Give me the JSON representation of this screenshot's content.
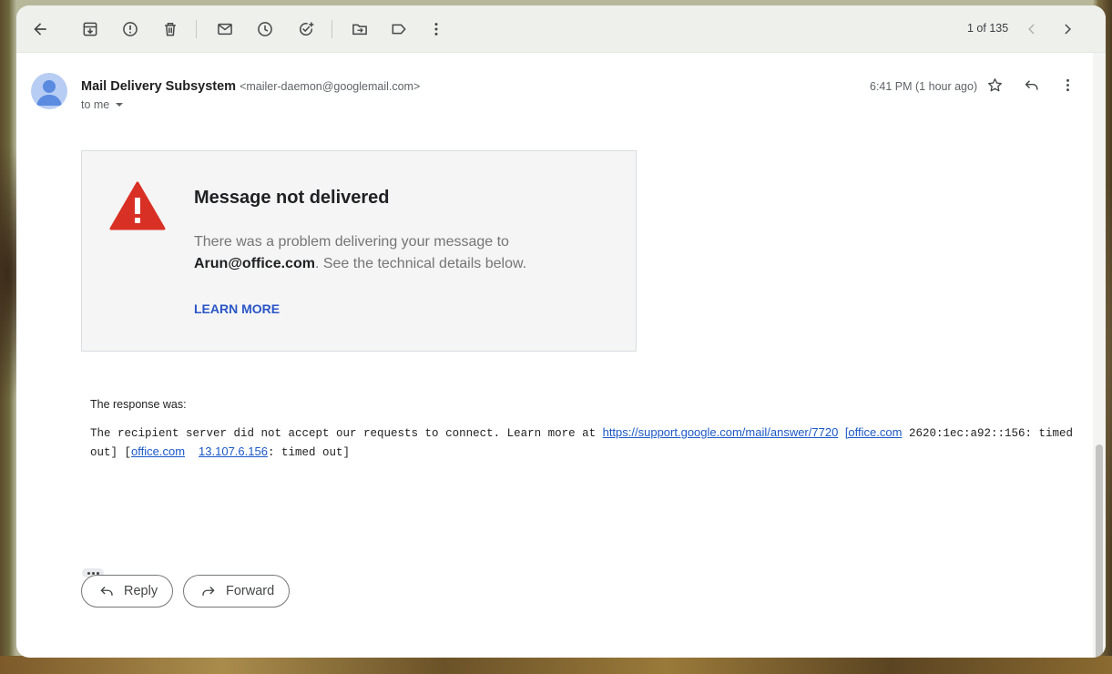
{
  "toolbar": {
    "pager": "1 of 135"
  },
  "message": {
    "sender_name": "Mail Delivery Subsystem",
    "sender_email": "<mailer-daemon@googlemail.com>",
    "to_label": "to me",
    "time": "6:41 PM (1 hour ago)"
  },
  "ndr": {
    "title": "Message not delivered",
    "text_before": "There was a problem delivering your message to",
    "recipient": "Arun@office.com",
    "text_after": ". See the technical details below.",
    "learn_more": "LEARN MORE"
  },
  "response": {
    "label": "The response was:",
    "text1": "The recipient server did not accept our requests to connect. Learn more at ",
    "link1": "https://support.google.com/mail/answer/7720",
    "link2": "[office.com",
    "text2": " 2620:1ec:a92::156: timed out] [",
    "link3": "office.com",
    "link4": "13.107.6.156",
    "text3": ": timed out]"
  },
  "actions": {
    "reply": "Reply",
    "forward": "Forward"
  },
  "colors": {
    "accent_link": "#1a57c7",
    "learn_more": "#2a56c6",
    "warning": "#d93025"
  }
}
